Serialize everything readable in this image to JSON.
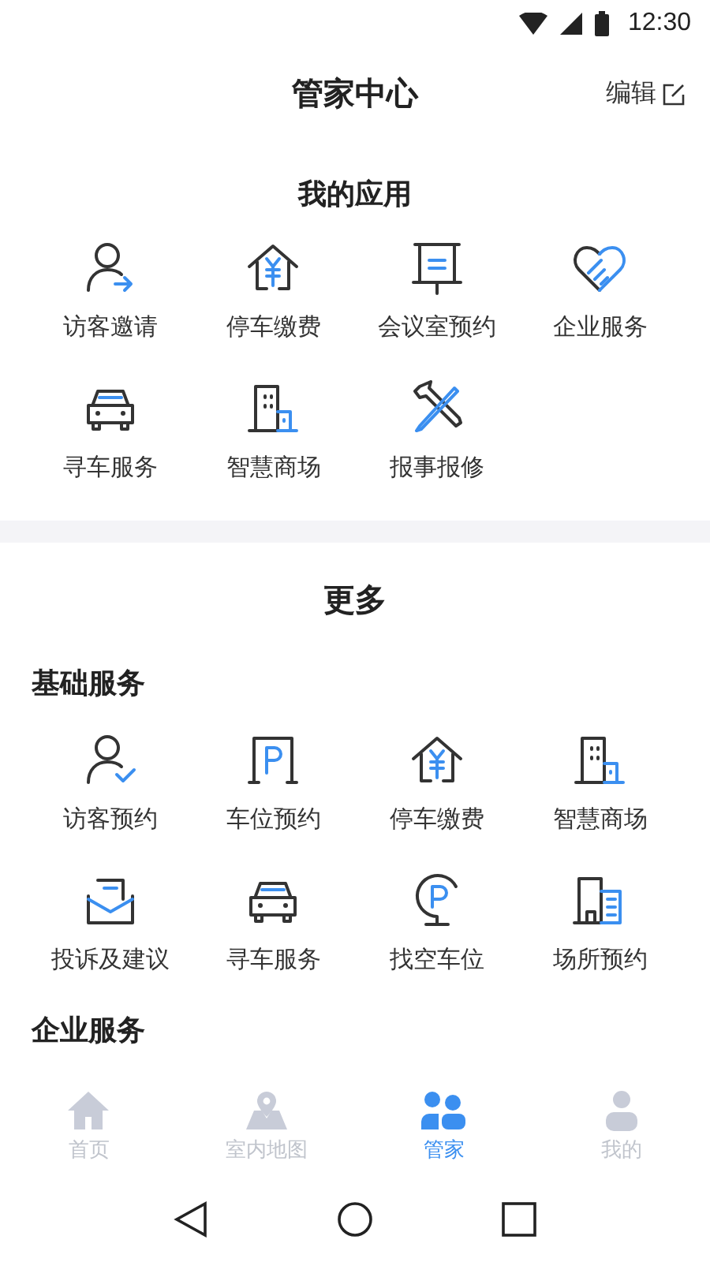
{
  "status_bar": {
    "time": "12:30"
  },
  "header": {
    "title": "管家中心",
    "edit": "编辑"
  },
  "my_apps": {
    "title": "我的应用",
    "items": [
      {
        "label": "访客邀请"
      },
      {
        "label": "停车缴费"
      },
      {
        "label": "会议室预约"
      },
      {
        "label": "企业服务"
      },
      {
        "label": "寻车服务"
      },
      {
        "label": "智慧商场"
      },
      {
        "label": "报事报修"
      }
    ]
  },
  "more": {
    "title": "更多",
    "sections": [
      {
        "title": "基础服务",
        "items": [
          {
            "label": "访客预约"
          },
          {
            "label": "车位预约"
          },
          {
            "label": "停车缴费"
          },
          {
            "label": "智慧商场"
          },
          {
            "label": "投诉及建议"
          },
          {
            "label": "寻车服务"
          },
          {
            "label": "找空车位"
          },
          {
            "label": "场所预约"
          }
        ]
      },
      {
        "title": "企业服务"
      }
    ]
  },
  "tab_bar": [
    {
      "label": "首页",
      "selected": false
    },
    {
      "label": "室内地图",
      "selected": false
    },
    {
      "label": "管家",
      "selected": true
    },
    {
      "label": "我的",
      "selected": false
    }
  ]
}
